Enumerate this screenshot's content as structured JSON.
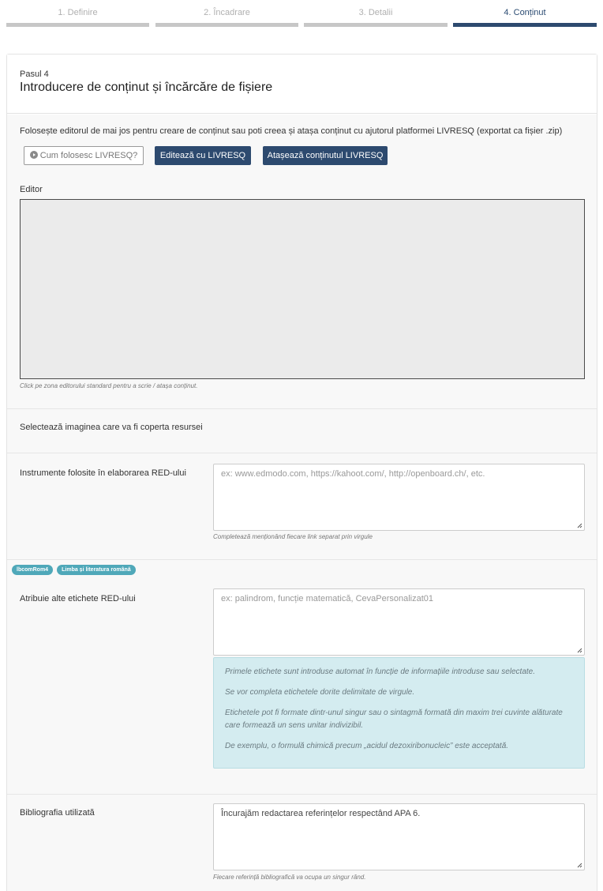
{
  "stepper": {
    "steps": [
      {
        "label": "1. Definire",
        "active": false
      },
      {
        "label": "2. Încadrare",
        "active": false
      },
      {
        "label": "3. Detalii",
        "active": false
      },
      {
        "label": "4. Conținut",
        "active": true
      }
    ]
  },
  "header": {
    "step": "Pasul 4",
    "title": "Introducere de conținut și încărcăre de fișiere"
  },
  "content": {
    "intro": "Folosește editorul de mai jos pentru creare de conținut sau poti creea și atașa conținut cu ajutorul platformei LIVRESQ (exportat ca fișier .zip)",
    "help_button": "Cum folosesc LIVRESQ?",
    "edit_button": "Editează cu LIVRESQ",
    "attach_button": "Atașează conținutul LIVRESQ",
    "editor_label": "Editor",
    "editor_help": "Click pe zona editorului standard pentru a scrie / atașa conținut."
  },
  "cover": {
    "label": "Selectează imaginea care va fi coperta resursei"
  },
  "tools": {
    "label": "Instrumente folosite în elaborarea RED-ului",
    "placeholder": "ex: www.edmodo.com, https://kahoot.com/, http://openboard.ch/, etc.",
    "help": "Completează menționând fiecare link separat prin virgule"
  },
  "tags": [
    "lbcomRom4",
    "Limba și literatura română"
  ],
  "labels_field": {
    "label": "Atribuie alte etichete RED-ului",
    "placeholder": "ex: palindrom, funcție matematică, CevaPersonalizat01",
    "info": [
      "Primele etichete sunt introduse automat în funcție de informațiile introduse sau selectate.",
      "Se vor completa etichetele dorite delimitate de virgule.",
      "Etichetele pot fi formate dintr-unul singur sau o sintagmă formată din maxim trei cuvinte alăturate care formează un sens unitar indivizibil.",
      "De exemplu, o formulă chimică precum „acidul dezoxiribonucleic” este acceptată."
    ]
  },
  "bibliography": {
    "label": "Bibliografia utilizată",
    "value": "Încurajăm redactarea referințelor respectând APA 6.",
    "help": "Fiecare referință bibliografică va ocupa un singur rând."
  },
  "colors": {
    "primary": "#2d4a6f",
    "tag": "#4fa8b9",
    "info_bg": "#d4ecf0",
    "step_inactive": "#c7c7c7"
  }
}
